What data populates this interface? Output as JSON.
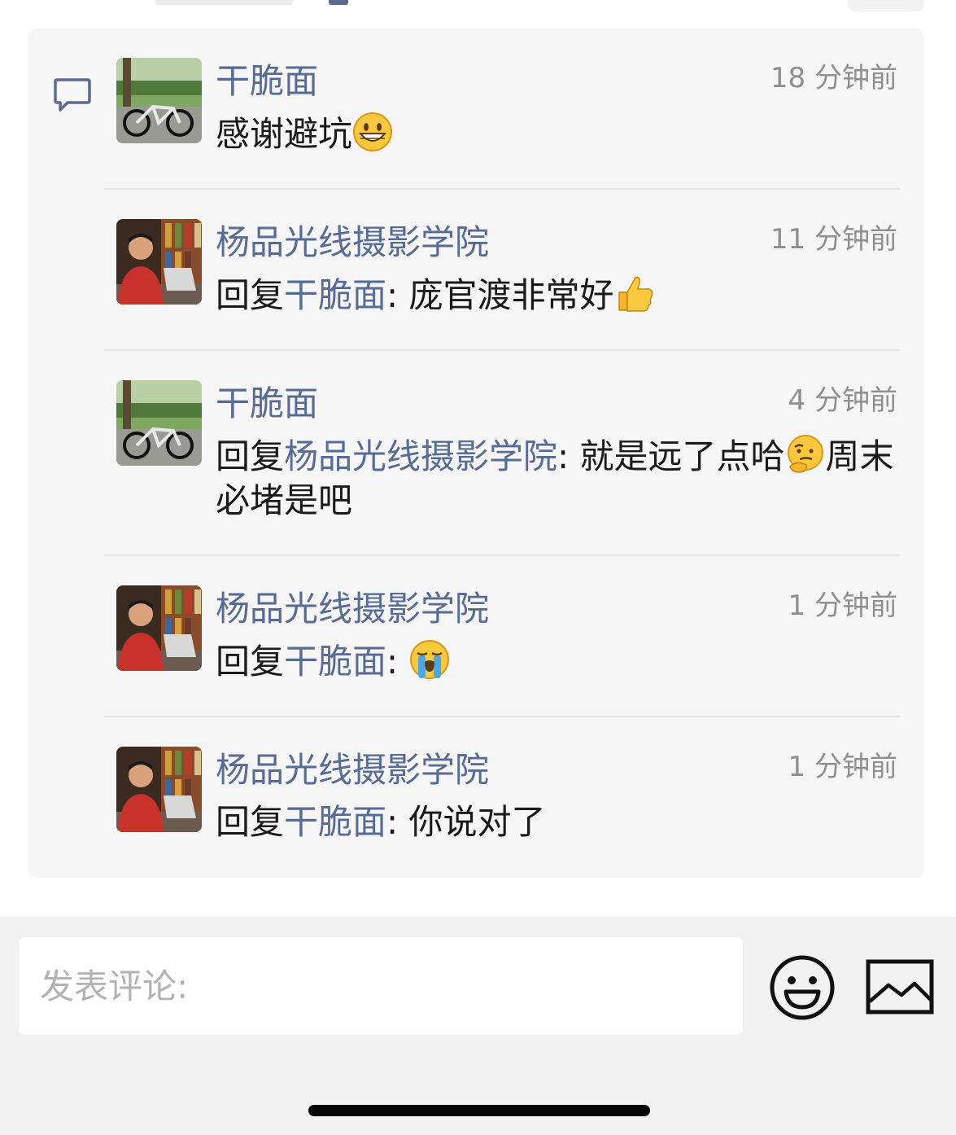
{
  "comments": [
    {
      "author": "干脆面",
      "time": "18 分钟前",
      "avatar": "bicycle-avatar",
      "text": "感谢避坑",
      "emoji": "grinning-face-emoji"
    },
    {
      "author": "杨品光线摄影学院",
      "time": "11 分钟前",
      "avatar": "person-avatar",
      "reply_prefix": "回复",
      "reply_to": "干脆面",
      "separator": ":",
      "text": " 庞官渡非常好",
      "emoji": "thumbs-up-emoji"
    },
    {
      "author": "干脆面",
      "time": "4 分钟前",
      "avatar": "bicycle-avatar",
      "reply_prefix": "回复",
      "reply_to": "杨品光线摄影学院",
      "separator": ":",
      "text": " 就是远了点哈",
      "emoji": "thinking-face-emoji",
      "text_after": "周末必堵是吧"
    },
    {
      "author": "杨品光线摄影学院",
      "time": "1 分钟前",
      "avatar": "person-avatar",
      "reply_prefix": "回复",
      "reply_to": "干脆面",
      "separator": ":",
      "text": " ",
      "emoji": "loudly-crying-face-emoji"
    },
    {
      "author": "杨品光线摄影学院",
      "time": "1 分钟前",
      "avatar": "person-avatar",
      "reply_prefix": "回复",
      "reply_to": "干脆面",
      "separator": ":",
      "text": " 你说对了"
    }
  ],
  "input": {
    "placeholder": "发表评论:"
  },
  "colors": {
    "name_link": "#566b96",
    "panel_bg": "#f6f6f7",
    "time_gray": "#8f8f8f"
  }
}
